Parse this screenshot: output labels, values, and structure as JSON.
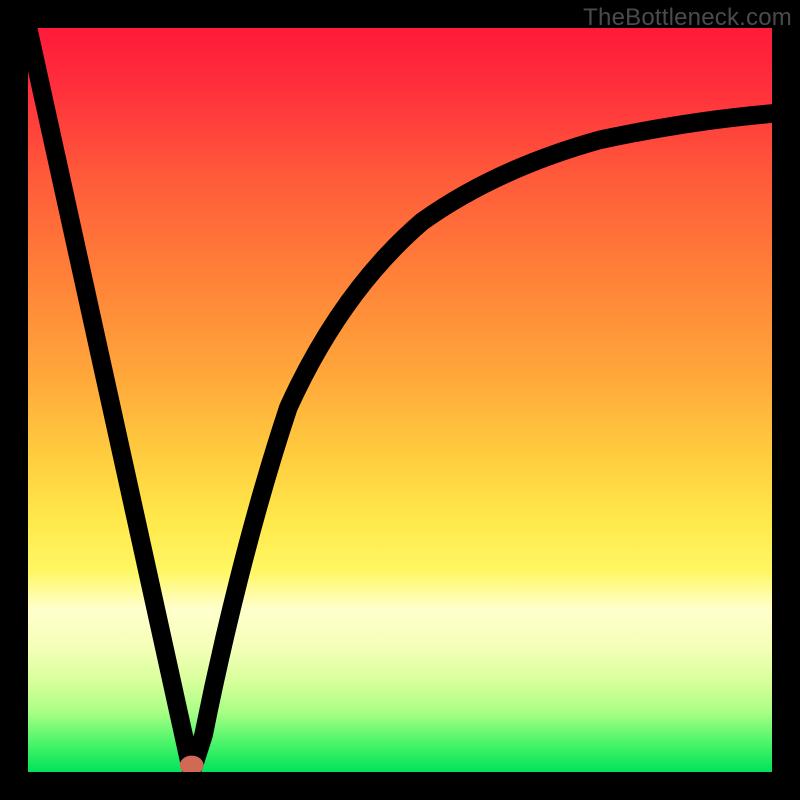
{
  "watermark": "TheBottleneck.com",
  "chart_data": {
    "type": "line",
    "title": "",
    "xlabel": "",
    "ylabel": "",
    "xlim": [
      0,
      100
    ],
    "ylim": [
      0,
      100
    ],
    "grid": false,
    "legend": false,
    "series": [
      {
        "name": "left-segment",
        "x": [
          0,
          22
        ],
        "y": [
          100,
          0
        ]
      },
      {
        "name": "right-segment",
        "x": [
          22,
          26,
          30,
          35,
          40,
          46,
          53,
          60,
          68,
          77,
          88,
          100
        ],
        "y": [
          0,
          17,
          34,
          49,
          60,
          68,
          74,
          79,
          82.5,
          85,
          87,
          88.5
        ]
      }
    ],
    "marker": {
      "x": 22,
      "y": 0,
      "rx": 1.1,
      "ry": 0.8,
      "color": "#d06a55"
    }
  },
  "colors": {
    "gradient_top": "#ff1a3a",
    "gradient_mid": "#ffce3f",
    "gradient_bottom": "#00e25a",
    "curve": "#000000",
    "frame": "#000000",
    "marker": "#d06a55"
  }
}
